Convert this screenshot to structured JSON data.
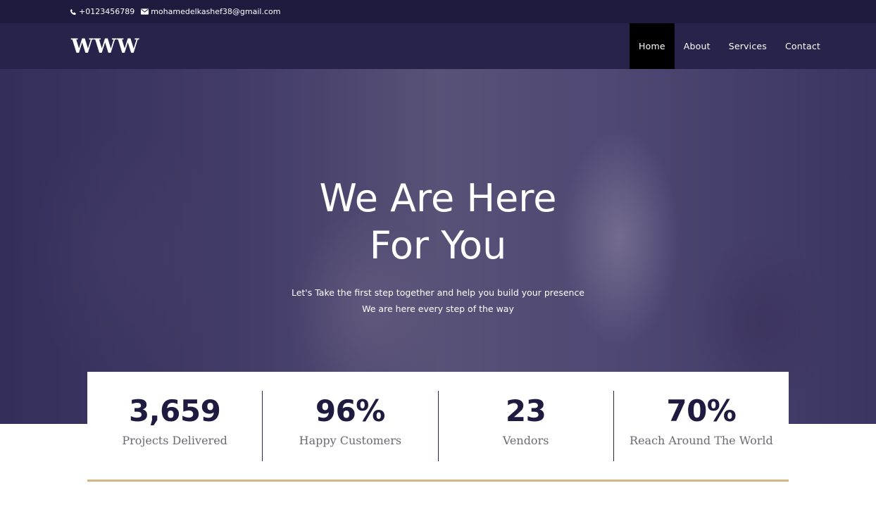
{
  "topbar": {
    "phone": "+0123456789",
    "email": "mohamedelkashef38@gmail.com",
    "phone_icon": "phone-icon",
    "email_icon": "envelope-icon"
  },
  "header": {
    "logo": "WWW",
    "nav": [
      {
        "label": "Home",
        "active": true
      },
      {
        "label": "About",
        "active": false
      },
      {
        "label": "Services",
        "active": false
      },
      {
        "label": "Contact",
        "active": false
      }
    ]
  },
  "hero": {
    "title_line1": "We Are Here",
    "title_line2": "For You",
    "subtitle_line1": "Let's Take the first step together and help you build your presence",
    "subtitle_line2": "We are here every step of the way"
  },
  "stats": [
    {
      "value": "3,659",
      "label": "Projects Delivered"
    },
    {
      "value": "96%",
      "label": "Happy Customers"
    },
    {
      "value": "23",
      "label": "Vendors"
    },
    {
      "value": "70%",
      "label": "Reach Around The World"
    }
  ],
  "colors": {
    "topbar_bg": "#1e1b3e",
    "header_bg": "#27234a",
    "active_nav_bg": "#000000",
    "stat_number": "#1f1b40",
    "accent_line": "#d4b680"
  }
}
